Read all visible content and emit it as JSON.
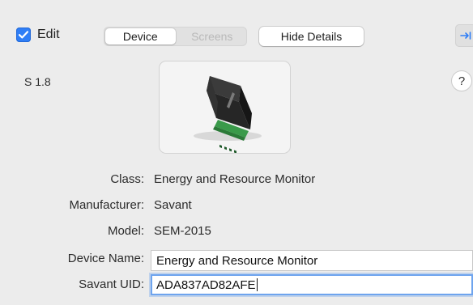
{
  "toolbar": {
    "edit_label": "Edit",
    "edit_checked": true,
    "tabs": [
      {
        "label": "Device",
        "active": true
      },
      {
        "label": "Screens",
        "active": false
      }
    ],
    "hide_details_label": "Hide Details"
  },
  "device": {
    "version": "S 1.8",
    "image_icon": "device-thumbnail",
    "help_label": "?"
  },
  "info": {
    "class_label": "Class:",
    "class_value": "Energy and Resource Monitor",
    "manufacturer_label": "Manufacturer:",
    "manufacturer_value": "Savant",
    "model_label": "Model:",
    "model_value": "SEM-2015",
    "device_name_label": "Device Name:",
    "device_name_value": "Energy and Resource Monitor",
    "uid_label": "Savant UID:",
    "uid_value": "ADA837AD82AFE"
  },
  "colors": {
    "accent": "#2f7ef6",
    "focus_ring": "#6ea4ee",
    "background": "#ececec"
  }
}
